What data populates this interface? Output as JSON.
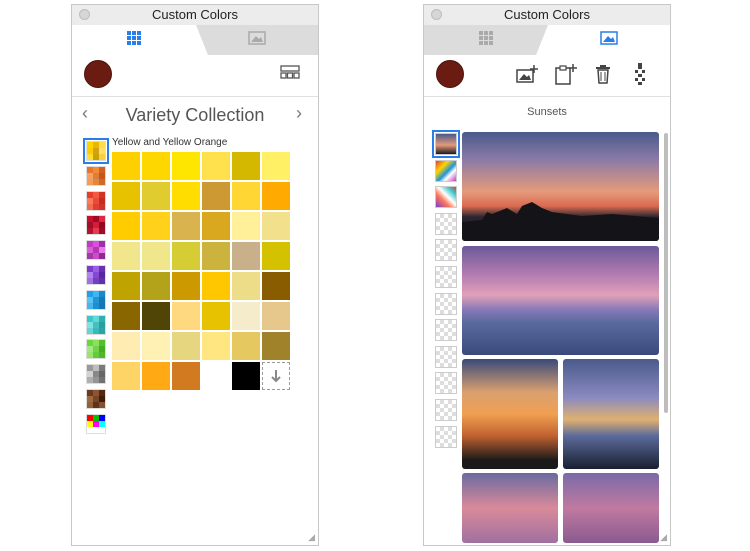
{
  "left_window": {
    "title": "Custom Colors",
    "tabs": [
      {
        "name": "swatches",
        "icon": "grid-icon",
        "active": true
      },
      {
        "name": "images",
        "icon": "image-icon",
        "active": false
      }
    ],
    "current_color": "#6b1c12",
    "collection": {
      "title": "Variety Collection",
      "prev_label": "‹",
      "next_label": "›",
      "palette_title": "Yellow and Yellow Orange",
      "palette_thumbs": [
        [
          "#ffd500",
          "#e6b800",
          "#ffdb4d",
          "#ffcc00",
          "#d4a017",
          "#ffe066",
          "#ffdd33",
          "#c9a200",
          "#f5d142"
        ],
        [
          "#e8742d",
          "#f28a3a",
          "#d35f20",
          "#f4a261",
          "#e07b39",
          "#c8561a",
          "#f59c5b",
          "#e3863f",
          "#cf6b2a"
        ],
        [
          "#e63c2e",
          "#f25a3f",
          "#d13326",
          "#ff7a59",
          "#e84a3b",
          "#c72b20",
          "#f46a52",
          "#e23f30",
          "#cc3528"
        ],
        [
          "#c8102e",
          "#9e0b24",
          "#e0283f",
          "#a30f2b",
          "#d81b3a",
          "#8e0a20",
          "#b5142e",
          "#e33b4f",
          "#9c0c26"
        ],
        [
          "#c13cc1",
          "#e04be0",
          "#9b2fb0",
          "#d95cd9",
          "#b13ab1",
          "#e879e8",
          "#a43aa4",
          "#cf49cf",
          "#8d2a8d"
        ],
        [
          "#7d3cc8",
          "#9b5de5",
          "#6a2fb0",
          "#b084f0",
          "#8447d6",
          "#5a25a0",
          "#a170e6",
          "#7340c0",
          "#6231a8"
        ],
        [
          "#1fa0e8",
          "#3fb6f2",
          "#1a88c9",
          "#58c3f5",
          "#2294d8",
          "#137ab8",
          "#49b5ee",
          "#1c8fd0",
          "#1578b3"
        ],
        [
          "#3cc8c8",
          "#5edada",
          "#2fb0b0",
          "#7fe3e3",
          "#44c0c0",
          "#28a0a0",
          "#66d4d4",
          "#38baba",
          "#2aa5a5"
        ],
        [
          "#6ad640",
          "#8be060",
          "#52c02c",
          "#a4e880",
          "#72d34a",
          "#44ad22",
          "#97e46f",
          "#63cb3c",
          "#4eb72b"
        ],
        [
          "#9a9a9a",
          "#bdbdbd",
          "#7a7a7a",
          "#d2d2d2",
          "#888888",
          "#666666",
          "#b0b0b0",
          "#959595",
          "#727272"
        ],
        [
          "#6b3a1e",
          "#8a5530",
          "#52280f",
          "#a06a40",
          "#7a4524",
          "#3f1d08",
          "#946038",
          "#5e3318",
          "#86502a"
        ],
        [
          "#ff0000",
          "#00c000",
          "#0000ff",
          "#ffff00",
          "#ff00ff",
          "#00ffff",
          "#ffffff",
          "#ffffff",
          "#ffffff"
        ]
      ],
      "swatches": [
        "#ffd000",
        "#ffd700",
        "#ffe600",
        "#ffe14d",
        "#d4b800",
        "#fff066",
        "#e6c200",
        "#e0cc2e",
        "#ffdd00",
        "#cc9933",
        "#ffd633",
        "#ffaa00",
        "#ffcc00",
        "#ffd11a",
        "#d9b34d",
        "#d9a81f",
        "#fff099",
        "#f2e08c",
        "#f2e68c",
        "#f0e68c",
        "#d6cc33",
        "#ccb33d",
        "#c8b08a",
        "#d4c200",
        "#bfa300",
        "#b3a31a",
        "#cc9900",
        "#ffc700",
        "#eedd88",
        "#8a5c00",
        "#8a6600",
        "#514407",
        "#ffd980",
        "#e6c200",
        "#f5eccc",
        "#e6c88c",
        "#ffecb3",
        "#fff0b3",
        "#e6d680",
        "#ffe680",
        "#e6c860",
        "#a0822a",
        "#ffd466",
        "#ffaa14",
        "#d17a20",
        "#ffffff",
        "#000000",
        "download"
      ]
    }
  },
  "right_window": {
    "title": "Custom Colors",
    "tabs": [
      {
        "name": "swatches",
        "icon": "grid-icon",
        "active": false
      },
      {
        "name": "images",
        "icon": "image-icon",
        "active": true
      }
    ],
    "current_color": "#6b1c12",
    "album_title": "Sunsets",
    "toolbar_icons": [
      "add-image-icon",
      "paste-image-icon",
      "trash-icon",
      "eyedropper-icon"
    ],
    "image_thumbs": [
      "sunset",
      "color-blocks",
      "color-blocks-2",
      "empty",
      "empty",
      "empty",
      "empty",
      "empty",
      "empty",
      "empty",
      "empty",
      "empty"
    ]
  }
}
